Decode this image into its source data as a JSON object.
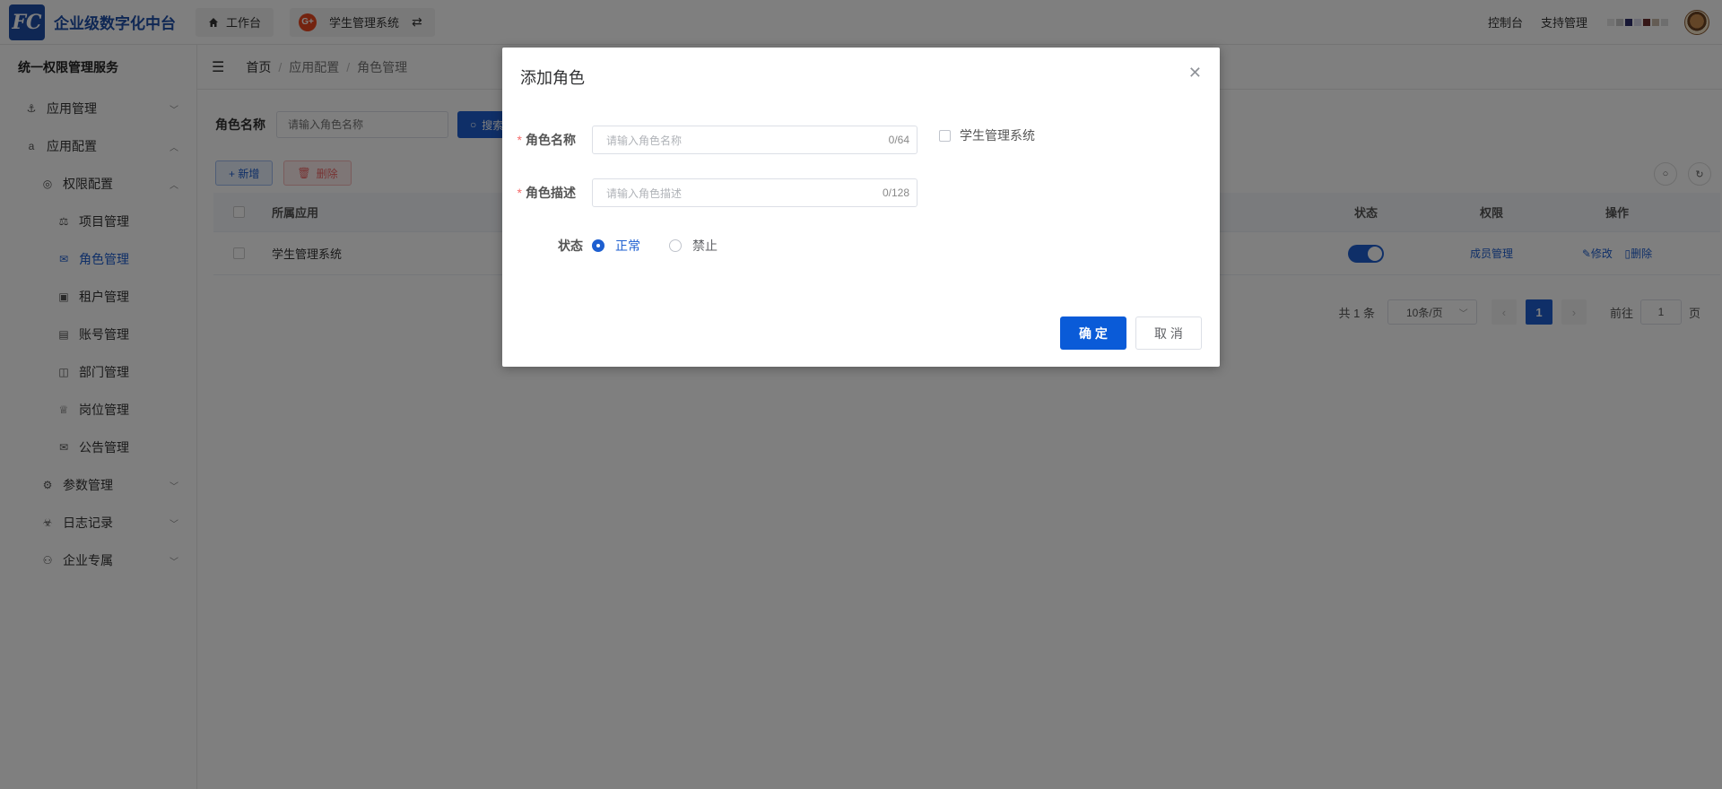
{
  "app": {
    "logo_mark": "FC",
    "title": "企业级数字化中台"
  },
  "top_tabs": {
    "workbench": "工作台",
    "system_badge": "G+",
    "system": "学生管理系统"
  },
  "top_right": {
    "console": "控制台",
    "support": "支持管理"
  },
  "sidebar": {
    "title": "统一权限管理服务",
    "items": [
      {
        "label": "应用管理",
        "icon": "anchor-icon"
      },
      {
        "label": "应用配置",
        "icon": "amazon-icon"
      },
      {
        "label": "权限配置",
        "icon": "chrome-icon"
      },
      {
        "label": "项目管理",
        "icon": "scale-icon"
      },
      {
        "label": "角色管理",
        "icon": "envelope-open-icon"
      },
      {
        "label": "租户管理",
        "icon": "bus-icon"
      },
      {
        "label": "账号管理",
        "icon": "inbox-icon"
      },
      {
        "label": "部门管理",
        "icon": "columns-icon"
      },
      {
        "label": "岗位管理",
        "icon": "basket-icon"
      },
      {
        "label": "公告管理",
        "icon": "mail-icon"
      },
      {
        "label": "参数管理",
        "icon": "gear-icon"
      },
      {
        "label": "日志记录",
        "icon": "biohazard-icon"
      },
      {
        "label": "企业专属",
        "icon": "user-plus-icon"
      }
    ]
  },
  "breadcrumb": {
    "home": "首页",
    "mid": "应用配置",
    "last": "角色管理"
  },
  "search": {
    "label": "角色名称",
    "placeholder": "请输入角色名称",
    "button": "搜索"
  },
  "toolbar": {
    "add": "+ 新增",
    "delete": "删除"
  },
  "table": {
    "headers": {
      "app": "所属应用",
      "status": "状态",
      "permission": "权限",
      "operation": "操作"
    },
    "rows": [
      {
        "app": "学生管理系统",
        "status_on": true,
        "permission": "成员管理",
        "edit": "修改",
        "delete": "删除"
      }
    ]
  },
  "pagination": {
    "total": "共 1 条",
    "page_size": "10条/页",
    "current": "1",
    "goto_prefix": "前往",
    "goto_value": "1",
    "goto_suffix": "页"
  },
  "dialog": {
    "title": "添加角色",
    "name_label": "角色名称",
    "name_placeholder": "请输入角色名称",
    "name_count": "0/64",
    "system_option": "学生管理系统",
    "desc_label": "角色描述",
    "desc_placeholder": "请输入角色描述",
    "desc_count": "0/128",
    "status_label": "状态",
    "status_normal": "正常",
    "status_disabled": "禁止",
    "confirm": "确 定",
    "cancel": "取 消"
  },
  "colors": {
    "primary": "#1e5fd0",
    "logo": "#1e4fa8",
    "danger": "#f56c6c"
  }
}
